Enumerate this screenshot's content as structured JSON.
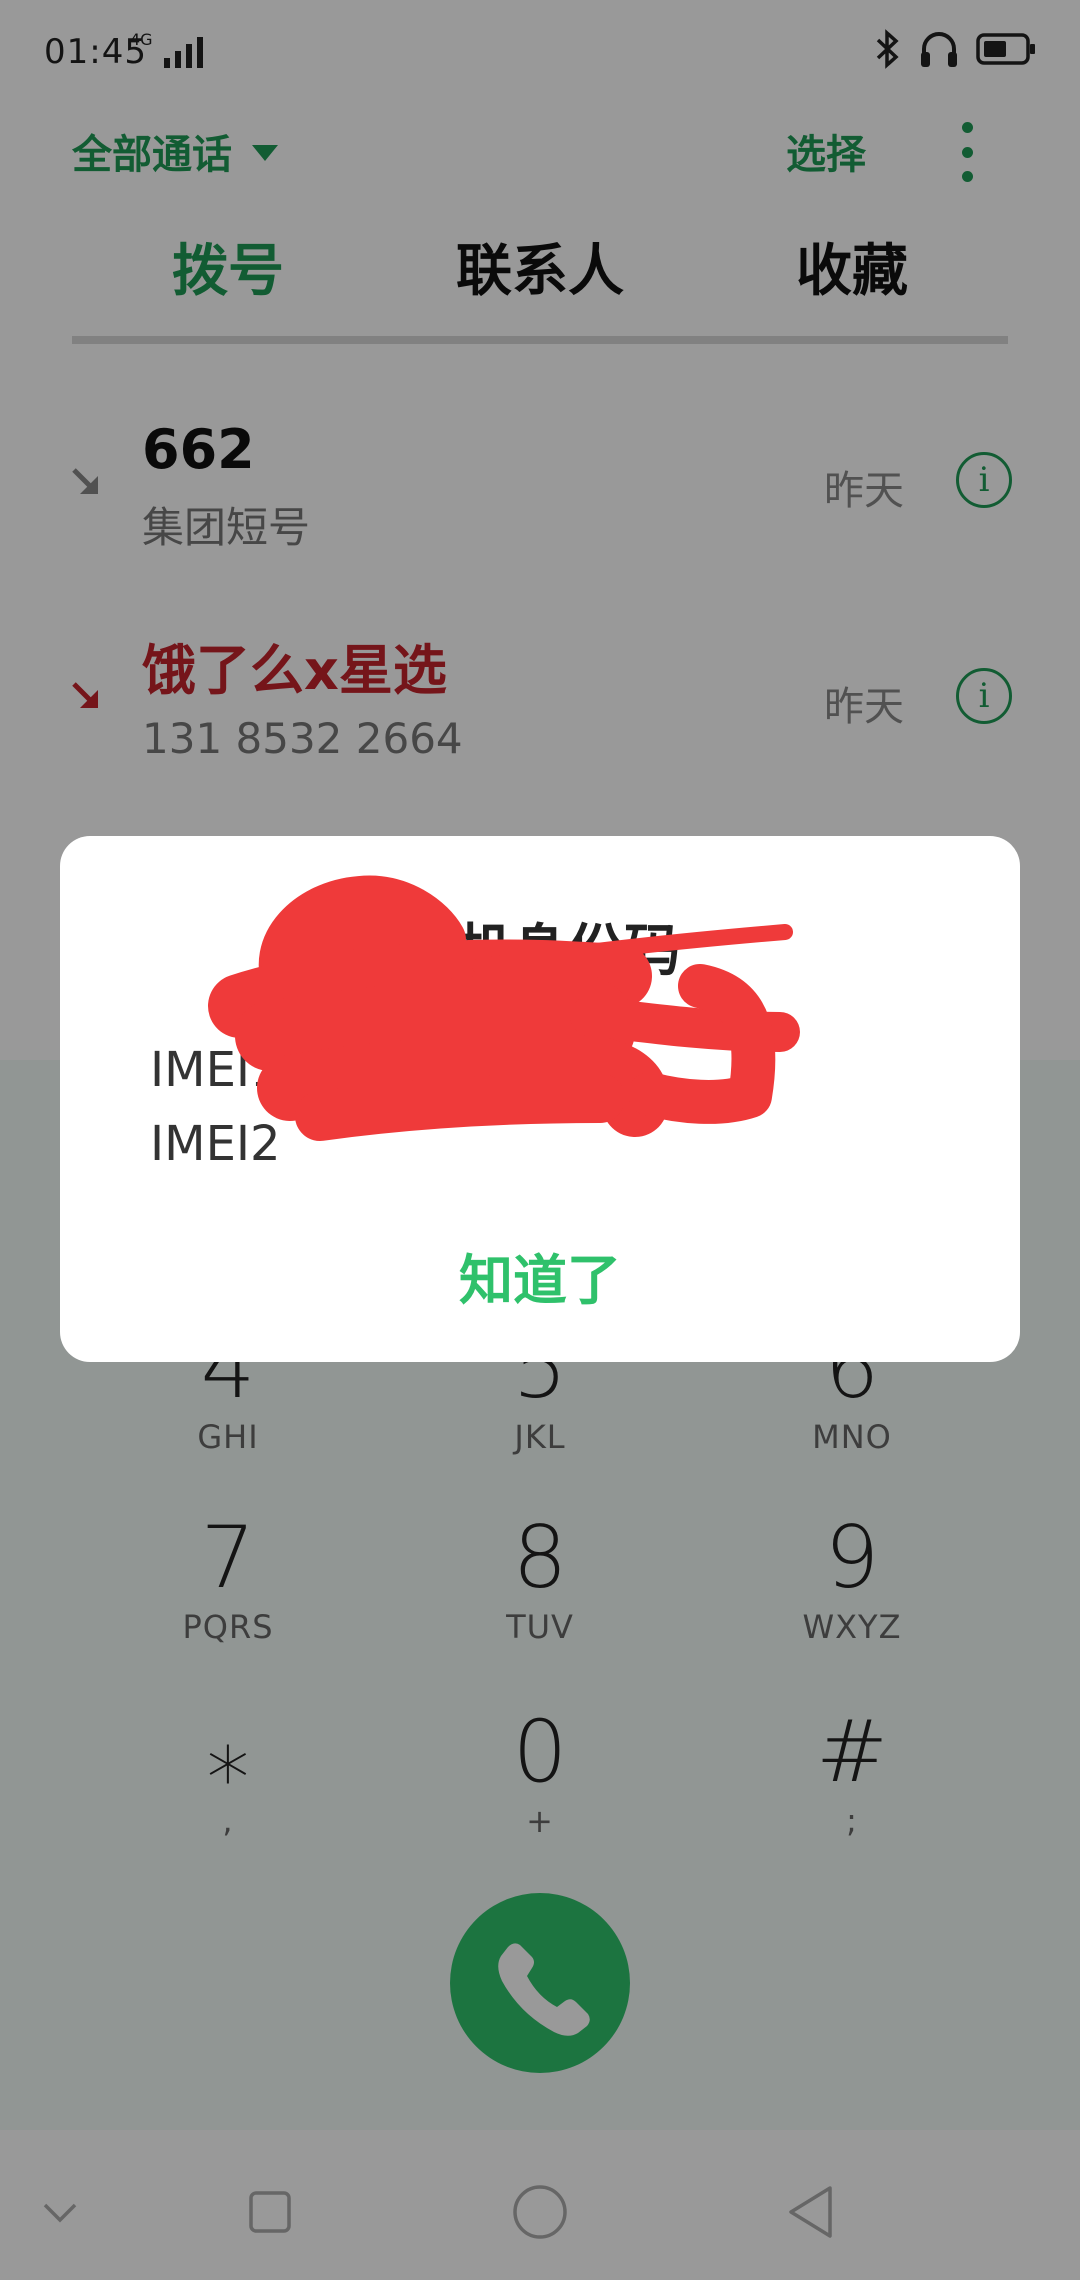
{
  "status_bar": {
    "time": "01:45",
    "network": "4G"
  },
  "toolbar": {
    "filter_label": "全部通话",
    "select_label": "选择"
  },
  "tabs": [
    {
      "label": "拨号",
      "active": true
    },
    {
      "label": "联系人",
      "active": false
    },
    {
      "label": "收藏",
      "active": false
    }
  ],
  "call_log": [
    {
      "name": "662",
      "subtitle": "集团短号",
      "time": "昨天",
      "type": "incoming"
    },
    {
      "name": "饿了么x星选",
      "subtitle": "131 8532 2664",
      "time": "昨天",
      "type": "missed"
    }
  ],
  "dialpad": {
    "keys": [
      {
        "digit": "4",
        "letters": "GHI"
      },
      {
        "digit": "5",
        "letters": "JKL"
      },
      {
        "digit": "6",
        "letters": "MNO"
      },
      {
        "digit": "7",
        "letters": "PQRS"
      },
      {
        "digit": "8",
        "letters": "TUV"
      },
      {
        "digit": "9",
        "letters": "WXYZ"
      },
      {
        "digit": "⁎",
        "letters": ","
      },
      {
        "digit": "0",
        "letters": "+"
      },
      {
        "digit": "#",
        "letters": ";"
      }
    ]
  },
  "dialog": {
    "title": "手机身份码",
    "imei1": "IMEI1:",
    "imei2": "IMEI2",
    "ok_label": "知道了"
  },
  "colors": {
    "accent": "#1f9a55",
    "missed": "#c4232c",
    "call_button": "#2fc16b",
    "redaction": "#ef3a3a"
  }
}
